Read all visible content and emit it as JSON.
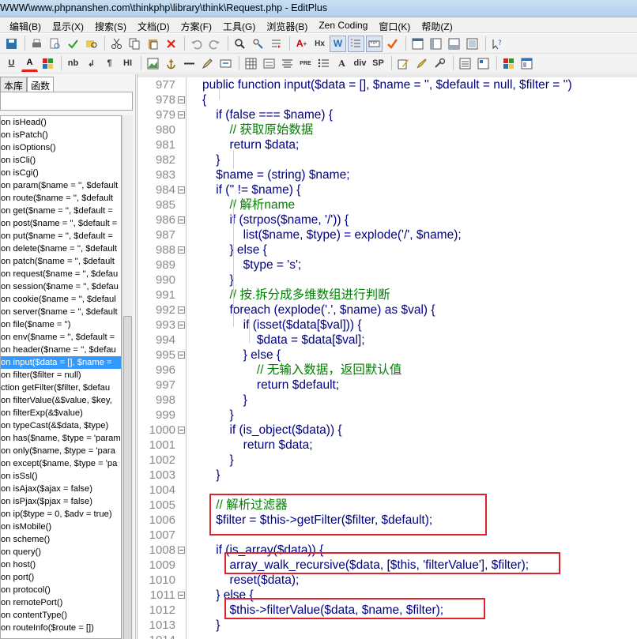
{
  "window": {
    "title": "WWW\\www.phpnanshen.com\\thinkphp\\library\\think\\Request.php - EditPlus"
  },
  "menus": [
    "编辑(B)",
    "显示(X)",
    "搜索(S)",
    "文档(D)",
    "方案(F)",
    "工具(G)",
    "浏览器(B)",
    "Zen Coding",
    "窗口(K)",
    "帮助(Z)"
  ],
  "toolbar2_labels": {
    "u": "U",
    "a": "A",
    "nb": "nb",
    "br": "↲",
    "para": "¶",
    "hl": "HI",
    "pre": "PRE",
    "div": "div",
    "sp": "SP",
    "ra": "A",
    "hx": "Hx",
    "w": "W"
  },
  "sidebar": {
    "tabs": [
      "本库",
      "函数"
    ],
    "functions": [
      "on isHead()",
      "on isPatch()",
      "on isOptions()",
      "on isCli()",
      "on isCgi()",
      "on param($name = '', $default",
      "on route($name = '', $default",
      "on get($name = '', $default =",
      "on post($name = '', $default =",
      "on put($name = '', $default =",
      "on delete($name = '', $default",
      "on patch($name = '', $default",
      "on request($name = '', $defau",
      "on session($name = '', $defau",
      "on cookie($name = '', $defaul",
      "on server($name = '', $default",
      "on file($name = '')",
      "on env($name = '', $default =",
      "on header($name = '', $defau",
      "on input($data = [], $name =",
      "on filter($filter = null)",
      "ction getFilter($filter, $defau",
      "on filterValue(&$value, $key,",
      "on filterExp(&$value)",
      "on typeCast(&$data, $type)",
      "on has($name, $type = 'param",
      "on only($name, $type = 'para",
      "on except($name, $type = 'pa",
      "on isSsl()",
      "on isAjax($ajax = false)",
      "on isPjax($pjax = false)",
      "on ip($type = 0, $adv = true)",
      "on isMobile()",
      "on scheme()",
      "on query()",
      "on host()",
      "on port()",
      "on protocol()",
      "on remotePort()",
      "on contentType()",
      "on routeInfo($route = [])"
    ],
    "selected_index": 19
  },
  "editor": {
    "lines": [
      {
        "n": "977",
        "t": "public function input($data = [], $name = '', $default = null, $filter = '')"
      },
      {
        "n": "978",
        "t": "{"
      },
      {
        "n": "979",
        "t": "    if (false === $name) {"
      },
      {
        "n": "980",
        "t": "        // 获取原始数据"
      },
      {
        "n": "981",
        "t": "        return $data;"
      },
      {
        "n": "982",
        "t": "    }"
      },
      {
        "n": "983",
        "t": "    $name = (string) $name;"
      },
      {
        "n": "984",
        "t": "    if ('' != $name) {"
      },
      {
        "n": "985",
        "t": "        // 解析name"
      },
      {
        "n": "986",
        "t": "        if (strpos($name, '/')) {"
      },
      {
        "n": "987",
        "t": "            list($name, $type) = explode('/', $name);"
      },
      {
        "n": "988",
        "t": "        } else {"
      },
      {
        "n": "989",
        "t": "            $type = 's';"
      },
      {
        "n": "990",
        "t": "        }"
      },
      {
        "n": "991",
        "t": "        // 按.拆分成多维数组进行判断"
      },
      {
        "n": "992",
        "t": "        foreach (explode('.', $name) as $val) {"
      },
      {
        "n": "993",
        "t": "            if (isset($data[$val])) {"
      },
      {
        "n": "994",
        "t": "                $data = $data[$val];"
      },
      {
        "n": "995",
        "t": "            } else {"
      },
      {
        "n": "996",
        "t": "                // 无输入数据，返回默认值"
      },
      {
        "n": "997",
        "t": "                return $default;"
      },
      {
        "n": "998",
        "t": "            }"
      },
      {
        "n": "999",
        "t": "        }"
      },
      {
        "n": "1000",
        "t": "        if (is_object($data)) {"
      },
      {
        "n": "1001",
        "t": "            return $data;"
      },
      {
        "n": "1002",
        "t": "        }"
      },
      {
        "n": "1003",
        "t": "    }"
      },
      {
        "n": "1004",
        "t": ""
      },
      {
        "n": "1005",
        "t": "    // 解析过滤器"
      },
      {
        "n": "1006",
        "t": "    $filter = $this->getFilter($filter, $default);"
      },
      {
        "n": "1007",
        "t": ""
      },
      {
        "n": "1008",
        "t": "    if (is_array($data)) {"
      },
      {
        "n": "1009",
        "t": "        array_walk_recursive($data, [$this, 'filterValue'], $filter);"
      },
      {
        "n": "1010",
        "t": "        reset($data);"
      },
      {
        "n": "1011",
        "t": "    } else {"
      },
      {
        "n": "1012",
        "t": "        $this->filterValue($data, $name, $filter);"
      },
      {
        "n": "1013",
        "t": "    }"
      },
      {
        "n": "1014",
        "t": ""
      }
    ],
    "fold_lines": [
      "978",
      "979",
      "984",
      "986",
      "988",
      "992",
      "993",
      "995",
      "1000",
      "1008",
      "1011"
    ]
  },
  "colors": {
    "keyword": "#0000ff",
    "comment": "#008000",
    "string": "#c00000",
    "plain": "#000080",
    "highlight_box": "#e0202a",
    "selection": "#3399ff"
  }
}
